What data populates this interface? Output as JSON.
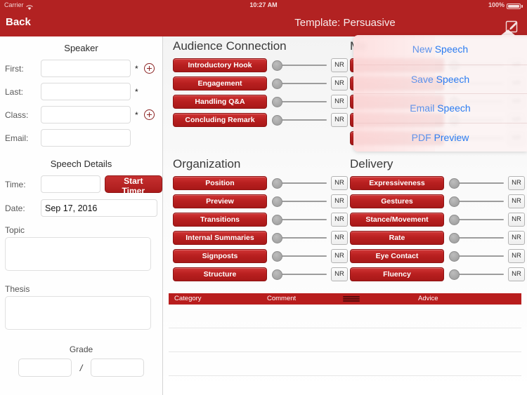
{
  "statusbar": {
    "carrier": "Carrier",
    "time": "10:27 AM",
    "battery": "100%",
    "wifi_icon": "wifi-icon",
    "battery_icon": "battery-icon"
  },
  "navbar": {
    "back_label": "Back",
    "title": "Template: Persuasive",
    "edit_icon": "compose-edit-icon"
  },
  "sidebar": {
    "speaker_heading": "Speaker",
    "fields": [
      {
        "label": "First:",
        "value": "",
        "required": "*",
        "has_add": true,
        "add_icon": "plus-circle-icon"
      },
      {
        "label": "Last:",
        "value": "",
        "required": "*",
        "has_add": false,
        "add_icon": ""
      },
      {
        "label": "Class:",
        "value": "",
        "required": "*",
        "has_add": true,
        "add_icon": "plus-circle-icon"
      },
      {
        "label": "Email:",
        "value": "",
        "required": "",
        "has_add": false,
        "add_icon": ""
      }
    ],
    "speech_heading": "Speech Details",
    "time_label": "Time:",
    "time_value": "",
    "start_timer_label": "Start Timer",
    "date_label": "Date:",
    "date_value": "Sep 17, 2016",
    "topic_label": "Topic",
    "topic_value": "",
    "thesis_label": "Thesis",
    "thesis_value": "",
    "grade_heading": "Grade",
    "grade_numerator": "",
    "grade_separator": "/",
    "grade_denominator": ""
  },
  "rubric": {
    "nr_label": "NR",
    "sections": [
      {
        "id": "audience",
        "title": "Audience Connection",
        "criteria": [
          "Introductory Hook",
          "Engagement",
          "Handling Q&A",
          "Concluding Remark"
        ]
      },
      {
        "id": "mechanics",
        "title": "Me",
        "criteria": [
          "",
          "",
          "",
          "",
          ""
        ]
      },
      {
        "id": "organization",
        "title": "Organization",
        "criteria": [
          "Position",
          "Preview",
          "Transitions",
          "Internal Summaries",
          "Signposts",
          "Structure"
        ]
      },
      {
        "id": "delivery",
        "title": "Delivery",
        "criteria": [
          "Expressiveness",
          "Gestures",
          "Stance/Movement",
          "Rate",
          "Eye Contact",
          "Fluency"
        ]
      }
    ]
  },
  "comments": {
    "columns": [
      "Category",
      "Comment",
      "Advice"
    ],
    "drag_handle_icon": "drag-handle-icon",
    "rows": [
      {
        "category": "",
        "comment": "",
        "advice": ""
      },
      {
        "category": "",
        "comment": "",
        "advice": ""
      },
      {
        "category": "",
        "comment": "",
        "advice": ""
      },
      {
        "category": "",
        "comment": "",
        "advice": ""
      }
    ]
  },
  "popover": {
    "items": [
      {
        "label": "New Speech"
      },
      {
        "label": "Save Speech"
      },
      {
        "label": "Email Speech"
      },
      {
        "label": "PDF Preview"
      }
    ]
  },
  "colors": {
    "brand_red": "#b22222",
    "button_red": "#b92020",
    "link_blue": "#2a7bf0",
    "table_header": "#b81d1d"
  }
}
